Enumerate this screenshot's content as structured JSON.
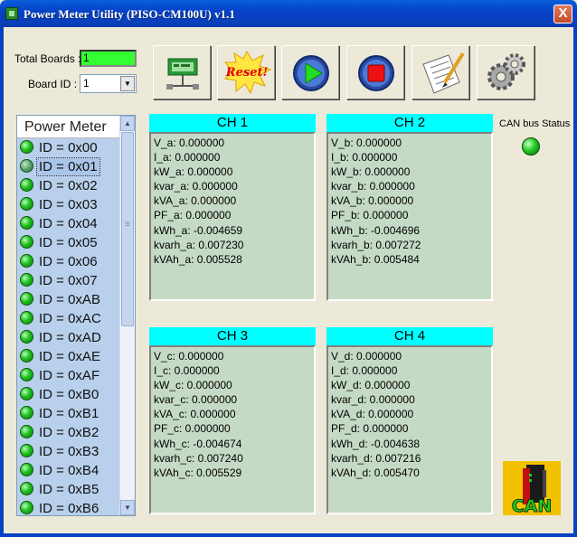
{
  "window": {
    "title": "Power Meter Utility (PISO-CM100U) v1.1",
    "close_glyph": "X"
  },
  "controls": {
    "total_boards_label": "Total Boards :",
    "total_boards_value": "1",
    "board_id_label": "Board ID :",
    "board_id_value": "1"
  },
  "toolbar": [
    {
      "name": "network-board-icon"
    },
    {
      "name": "reset-icon",
      "text": "Reset!"
    },
    {
      "name": "play-icon"
    },
    {
      "name": "stop-icon"
    },
    {
      "name": "notepad-icon"
    },
    {
      "name": "gears-icon"
    }
  ],
  "list": {
    "header": "Power Meter",
    "items": [
      "ID = 0x00",
      "ID = 0x01",
      "ID = 0x02",
      "ID = 0x03",
      "ID = 0x04",
      "ID = 0x05",
      "ID = 0x06",
      "ID = 0x07",
      "ID = 0xAB",
      "ID = 0xAC",
      "ID = 0xAD",
      "ID = 0xAE",
      "ID = 0xAF",
      "ID = 0xB0",
      "ID = 0xB1",
      "ID = 0xB2",
      "ID = 0xB3",
      "ID = 0xB4",
      "ID = 0xB5",
      "ID = 0xB6"
    ],
    "selected_index": 1
  },
  "channels": [
    {
      "title": "CH 1",
      "lines": [
        "V_a: 0.000000",
        "I_a: 0.000000",
        "kW_a: 0.000000",
        "kvar_a: 0.000000",
        "kVA_a: 0.000000",
        "PF_a: 0.000000",
        "kWh_a: -0.004659",
        "kvarh_a: 0.007230",
        "kVAh_a: 0.005528"
      ]
    },
    {
      "title": "CH 2",
      "lines": [
        "V_b: 0.000000",
        "I_b: 0.000000",
        "kW_b: 0.000000",
        "kvar_b: 0.000000",
        "kVA_b: 0.000000",
        "PF_b: 0.000000",
        "kWh_b: -0.004696",
        "kvarh_b: 0.007272",
        "kVAh_b: 0.005484"
      ]
    },
    {
      "title": "CH 3",
      "lines": [
        "V_c: 0.000000",
        "I_c: 0.000000",
        "kW_c: 0.000000",
        "kvar_c: 0.000000",
        "kVA_c: 0.000000",
        "PF_c: 0.000000",
        "kWh_c: -0.004674",
        "kvarh_c: 0.007240",
        "kVAh_c: 0.005529"
      ]
    },
    {
      "title": "CH 4",
      "lines": [
        "V_d: 0.000000",
        "I_d: 0.000000",
        "kW_d: 0.000000",
        "kvar_d: 0.000000",
        "kVA_d: 0.000000",
        "PF_d: 0.000000",
        "kWh_d: -0.004638",
        "kvarh_d: 0.007216",
        "kVAh_d: 0.005470"
      ]
    }
  ],
  "status": {
    "can_bus_label": "CAN bus Status",
    "can_logo_text": "CAN"
  },
  "colors": {
    "led_green": "#22cc22",
    "channel_header": "#00ffff",
    "channel_panel": "#c5dac5",
    "total_field": "#33ff33",
    "list_bg": "#b8d0ec"
  }
}
